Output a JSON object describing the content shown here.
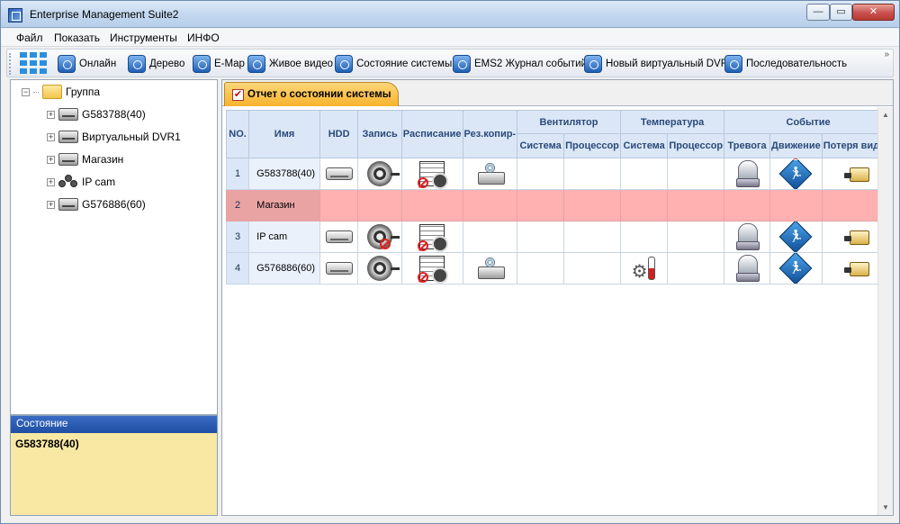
{
  "window": {
    "title": "Enterprise Management Suite2",
    "min": "—",
    "max": "▭",
    "close": "✕"
  },
  "menu": [
    "Файл",
    "Показать",
    "Инструменты",
    "ИНФО"
  ],
  "toolbar": {
    "buttons": [
      "Онлайн",
      "Дерево",
      "E-Map",
      "Живое видео",
      "Состояние системы",
      "EMS2 Журнал событий",
      "Новый виртуальный DVR",
      "Последовательность"
    ],
    "more": "»"
  },
  "tree": {
    "root": "Группа",
    "children": [
      "G583788(40)",
      "Виртуальный DVR1",
      "Магазин",
      "IP cam",
      "G576886(60)"
    ]
  },
  "status_panel": {
    "title": "Состояние",
    "value": "G583788(40)"
  },
  "tab": {
    "label": "Отчет о состоянии системы"
  },
  "table": {
    "headers": {
      "no": "NO.",
      "name": "Имя",
      "hdd": "HDD",
      "record": "Запись",
      "schedule": "Расписание",
      "backup": "Рез.копир-",
      "fan": "Вентилятор",
      "temperature": "Температура",
      "event": "Событие",
      "fan_system": "Система",
      "fan_cpu": "Процессор",
      "temp_system": "Система",
      "temp_cpu": "Процессор",
      "event_alarm": "Тревога",
      "event_motion": "Движение",
      "event_vloss": "Потеря видео"
    },
    "rows": [
      {
        "no": "1",
        "name": "G583788(40)",
        "hdd": "hdd-icon",
        "record": "record-icon",
        "schedule": "schedule-icon-disabled",
        "backup": "backup-icon",
        "temp_system": "",
        "alarm": "alarm-icon",
        "motion": "motion-icon-warning",
        "vloss": "video-loss-icon",
        "selected": false
      },
      {
        "no": "2",
        "name": "Магазин",
        "selected": true
      },
      {
        "no": "3",
        "name": "IP cam",
        "hdd": "hdd-icon",
        "record": "record-icon-disabled",
        "schedule": "schedule-icon-disabled",
        "backup": "",
        "temp_system": "",
        "alarm": "alarm-icon",
        "motion": "motion-icon",
        "vloss": "video-loss-icon",
        "selected": false
      },
      {
        "no": "4",
        "name": "G576886(60)",
        "hdd": "hdd-icon",
        "record": "record-icon",
        "schedule": "schedule-icon-disabled",
        "backup": "backup-icon",
        "temp_system": "temperature-icon",
        "alarm": "alarm-icon",
        "motion": "motion-icon",
        "vloss": "video-loss-icon",
        "selected": false
      }
    ]
  }
}
